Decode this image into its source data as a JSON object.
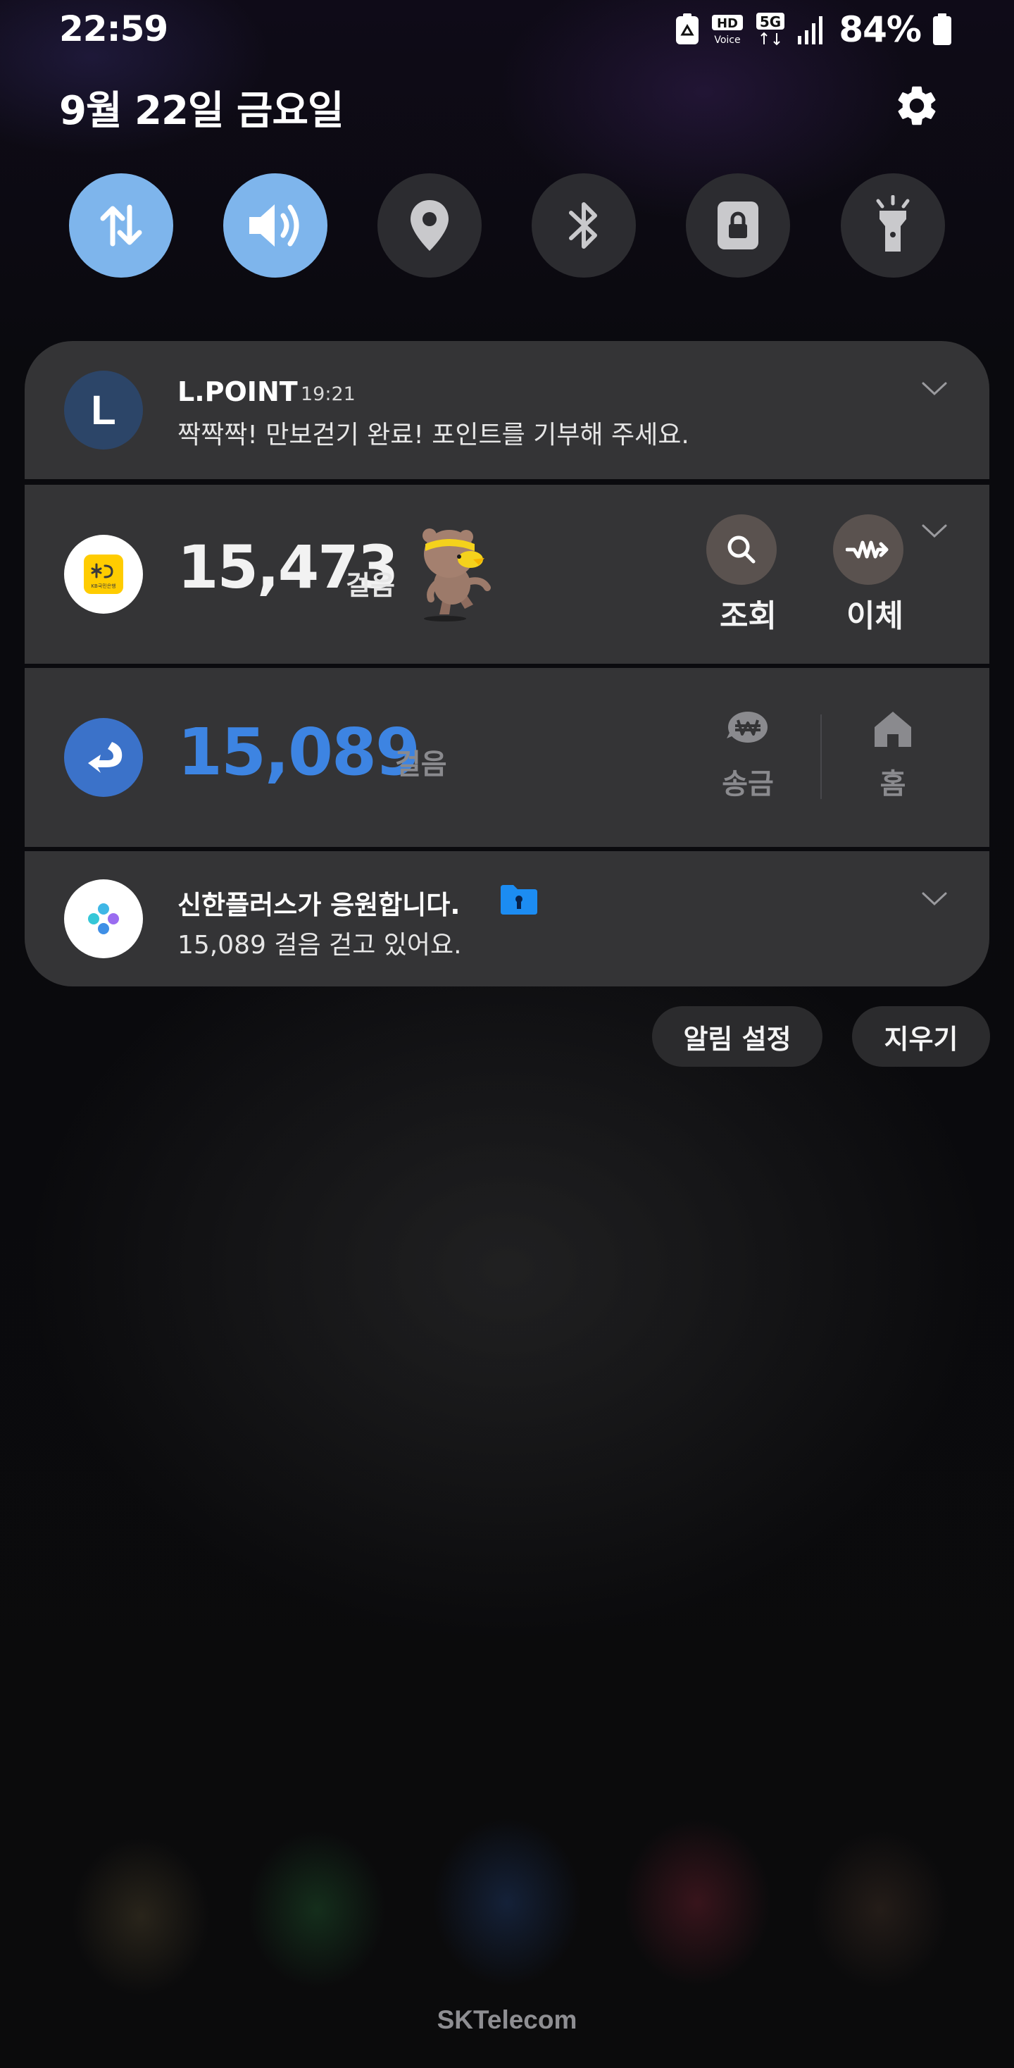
{
  "status_bar": {
    "time": "22:59",
    "battery_percent": "84%",
    "signal_type": "5G",
    "hd_label": "HD",
    "voice_label": "Voice",
    "icons": [
      "recycle-icon",
      "hd-voice-icon",
      "5g-icon",
      "signal-bars-icon",
      "battery-icon"
    ]
  },
  "header": {
    "date": "9월 22일 금요일",
    "settings_icon": "gear-icon"
  },
  "quick_settings": [
    {
      "name": "mobile-data",
      "icon": "data-arrows-icon",
      "active": true
    },
    {
      "name": "sound",
      "icon": "speaker-icon",
      "active": true
    },
    {
      "name": "location",
      "icon": "location-pin-icon",
      "active": false
    },
    {
      "name": "bluetooth",
      "icon": "bluetooth-icon",
      "active": false
    },
    {
      "name": "screen-lock",
      "icon": "lock-icon",
      "active": false
    },
    {
      "name": "flashlight",
      "icon": "flashlight-icon",
      "active": false
    }
  ],
  "notifications": {
    "lpoint": {
      "icon_letter": "L",
      "title": "L.POINT",
      "time": "19:21",
      "body": "짝짝짝! 만보걷기 완료! 포인트를 기부해 주세요."
    },
    "kb": {
      "icon_text": "KB국민은행",
      "steps": "15,473",
      "unit": "걸음",
      "actions": [
        {
          "label": "조회",
          "icon": "search-icon"
        },
        {
          "label": "이체",
          "icon": "transfer-icon"
        }
      ]
    },
    "toss": {
      "steps": "15,089",
      "unit": "걸음",
      "actions": [
        {
          "label": "송금",
          "icon": "won-send-icon"
        },
        {
          "label": "홈",
          "icon": "home-icon"
        }
      ]
    },
    "shinhan": {
      "title": "신한플러스가 응원합니다.",
      "body": "15,089 걸음 걷고 있어요."
    }
  },
  "buttons": {
    "notification_settings": "알림 설정",
    "clear": "지우기"
  },
  "carrier": "SKTelecom",
  "colors": {
    "toggle_active": "#7eb5ec",
    "toggle_inactive": "#2c2c30",
    "card_bg": "#343436",
    "toss_blue": "#3d84e2",
    "kb_yellow": "#ffcc00"
  }
}
